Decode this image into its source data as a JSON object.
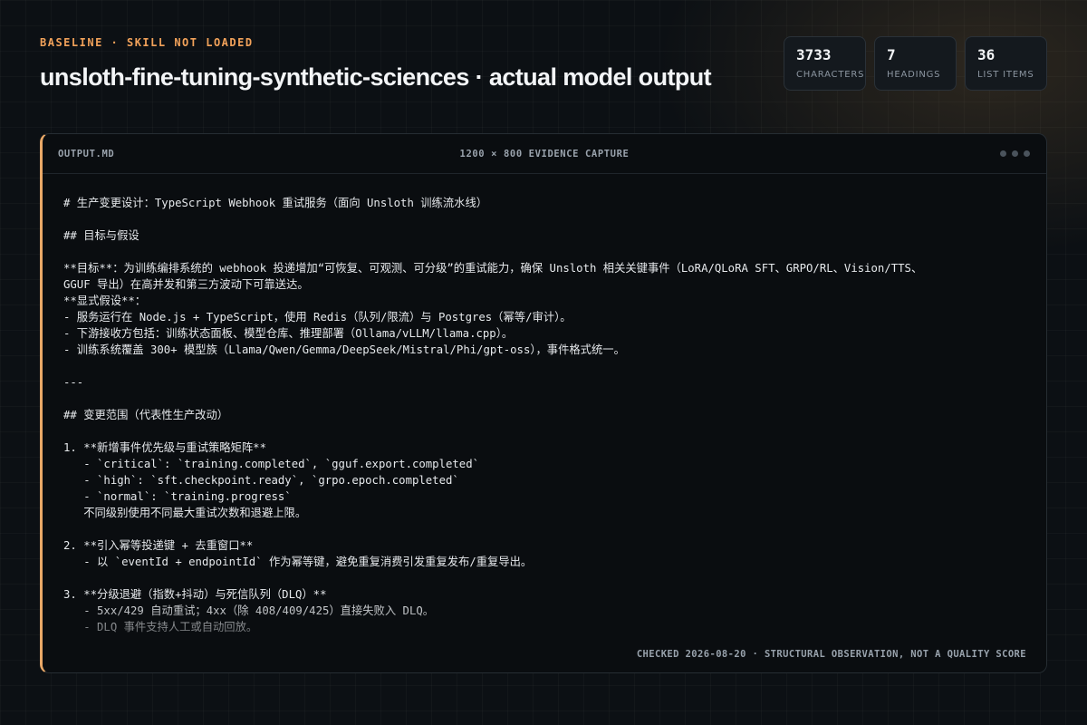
{
  "header": {
    "eyebrow": "BASELINE · SKILL NOT LOADED",
    "title": "unsloth-fine-tuning-synthetic-sciences · actual model output"
  },
  "stats": [
    {
      "value": "3733",
      "label": "CHARACTERS"
    },
    {
      "value": "7",
      "label": "HEADINGS"
    },
    {
      "value": "36",
      "label": "LIST ITEMS"
    }
  ],
  "panel": {
    "filename": "OUTPUT.MD",
    "caption": "1200 × 800 EVIDENCE CAPTURE",
    "footer_note": "CHECKED 2026-08-20 · STRUCTURAL OBSERVATION, NOT A QUALITY SCORE",
    "accent_color": "#e9a867",
    "content": "# 生产变更设计：TypeScript Webhook 重试服务（面向 Unsloth 训练流水线）\n\n## 目标与假设\n\n**目标**：为训练编排系统的 webhook 投递增加“可恢复、可观测、可分级”的重试能力，确保 Unsloth 相关关键事件（LoRA/QLoRA SFT、GRPO/RL、Vision/TTS、\nGGUF 导出）在高并发和第三方波动下可靠送达。\n**显式假设**：\n- 服务运行在 Node.js + TypeScript，使用 Redis（队列/限流）与 Postgres（幂等/审计）。\n- 下游接收方包括：训练状态面板、模型仓库、推理部署（Ollama/vLLM/llama.cpp）。\n- 训练系统覆盖 300+ 模型族（Llama/Qwen/Gemma/DeepSeek/Mistral/Phi/gpt-oss），事件格式统一。\n\n---\n\n## 变更范围（代表性生产改动）\n\n1. **新增事件优先级与重试策略矩阵**\n   - `critical`: `training.completed`, `gguf.export.completed`\n   - `high`: `sft.checkpoint.ready`, `grpo.epoch.completed`\n   - `normal`: `training.progress`\n   不同级别使用不同最大重试次数和退避上限。\n\n2. **引入幂等投递键 + 去重窗口**\n   - 以 `eventId + endpointId` 作为幂等键，避免重复消费引发重复发布/重复导出。\n\n3. **分级退避（指数+抖动）与死信队列（DLQ）**\n   - 5xx/429 自动重试；4xx（除 408/409/425）直接失败入 DLQ。\n   - DLQ 事件支持人工或自动回放。"
  }
}
